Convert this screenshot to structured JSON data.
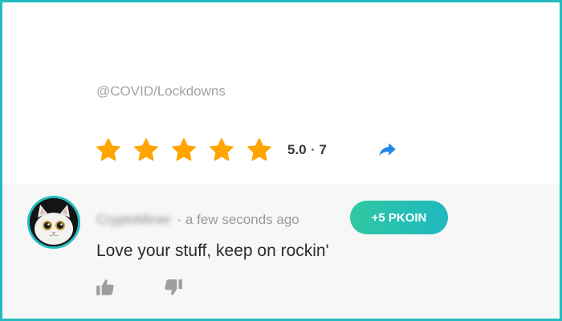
{
  "post": {
    "tag": "@COVID/Lockdowns",
    "rating": {
      "stars": 5,
      "value": "5.0",
      "separator": "•",
      "count": "7",
      "star_color": "#ffa400"
    },
    "share_icon": "share-arrow-icon"
  },
  "comment": {
    "username": "CryptoMiner",
    "separator": "·",
    "time_ago": "a few seconds ago",
    "reward_label": "+5 PKOIN",
    "text": "Love your stuff, keep on rockin'",
    "avatar_icon": "cat-avatar",
    "upvote_icon": "thumbs-up-icon",
    "downvote_icon": "thumbs-down-icon"
  },
  "colors": {
    "accent": "#22bcc0",
    "reward_gradient_start": "#2fc9a3",
    "reward_gradient_end": "#1fb7bf",
    "share": "#1e88e5"
  }
}
